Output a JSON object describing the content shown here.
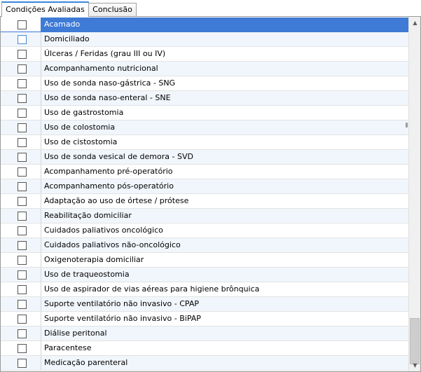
{
  "tabs": [
    {
      "label": "Condições Avaliadas",
      "active": true
    },
    {
      "label": "Conclusão",
      "active": false
    }
  ],
  "rows": [
    {
      "label": "Acamado",
      "checked": false,
      "selected": true
    },
    {
      "label": "Domiciliado",
      "checked": false
    },
    {
      "label": "Úlceras / Feridas (grau III ou IV)",
      "checked": false
    },
    {
      "label": "Acompanhamento nutricional",
      "checked": false
    },
    {
      "label": "Uso de sonda naso-gástrica - SNG",
      "checked": false
    },
    {
      "label": "Uso de sonda naso-enteral - SNE",
      "checked": false
    },
    {
      "label": "Uso de gastrostomia",
      "checked": false
    },
    {
      "label": "Uso de colostomia",
      "checked": false
    },
    {
      "label": "Uso de cistostomia",
      "checked": false
    },
    {
      "label": "Uso de sonda vesical de demora - SVD",
      "checked": false
    },
    {
      "label": "Acompanhamento pré-operatório",
      "checked": false
    },
    {
      "label": "Acompanhamento pós-operatório",
      "checked": false
    },
    {
      "label": "Adaptação ao uso de órtese / prótese",
      "checked": false
    },
    {
      "label": "Reabilitação domiciliar",
      "checked": false
    },
    {
      "label": "Cuidados paliativos oncológico",
      "checked": false
    },
    {
      "label": "Cuidados paliativos não-oncológico",
      "checked": false
    },
    {
      "label": "Oxigenoterapia domiciliar",
      "checked": false
    },
    {
      "label": "Uso de traqueostomia",
      "checked": false
    },
    {
      "label": "Uso de aspirador de vias aéreas para higiene brônquica",
      "checked": false
    },
    {
      "label": "Suporte ventilatório não invasivo - CPAP",
      "checked": false
    },
    {
      "label": "Suporte ventilatório não invasivo - BiPAP",
      "checked": false
    },
    {
      "label": "Diálise peritonal",
      "checked": false
    },
    {
      "label": "Paracentese",
      "checked": false
    },
    {
      "label": "Medicação parenteral",
      "checked": false
    }
  ],
  "scrollbar": {
    "up_icon": "triangle-up-icon",
    "down_icon": "triangle-down-icon"
  },
  "colors": {
    "selection": "#3e7ad6",
    "tab_accent": "#3b86d8",
    "alt_row": "#f1f6fc"
  }
}
